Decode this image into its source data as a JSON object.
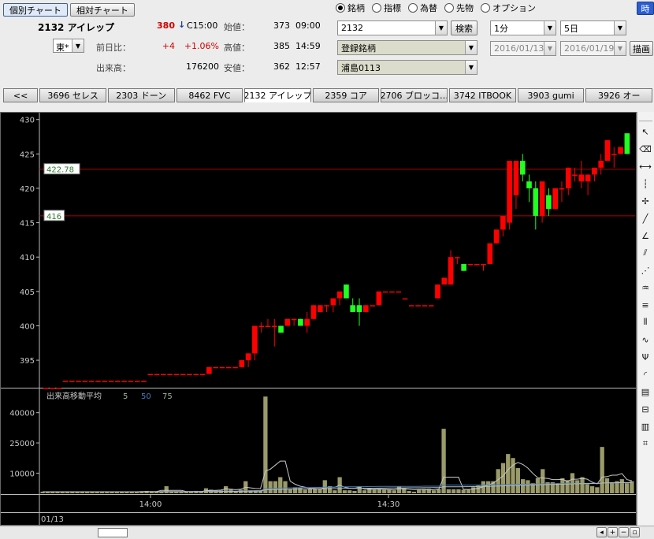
{
  "header": {
    "tab_individual": "個別チャート",
    "tab_relative": "相対チャート",
    "stock_label": "2132 アイレップ",
    "exchange": "東*",
    "price": "380",
    "price_arrow": "↓",
    "price_time": "C15:00",
    "change_label": "前日比：",
    "change_value": "+4",
    "change_pct": "+1.06%",
    "volume_label": "出来高：",
    "volume_value": "176200",
    "open_label": "始値：",
    "open_value": "373",
    "open_time": "09:00",
    "high_label": "高値：",
    "high_value": "385",
    "high_time": "14:59",
    "low_label": "安値：",
    "low_value": "362",
    "low_time": "12:57"
  },
  "modes": {
    "options": [
      "銘柄",
      "指標",
      "為替",
      "先物",
      "オプション"
    ],
    "selected": "銘柄"
  },
  "controls": {
    "code_value": "2132",
    "search_label": "検索",
    "list_value": "登録銘柄",
    "group_value": "浦島0113",
    "interval_value": "1分",
    "period_value": "5日",
    "date_from": "2016/01/13",
    "date_to": "2016/01/19",
    "draw_label": "描画",
    "corner_label": "時"
  },
  "stock_tabs": {
    "back": "<<",
    "items": [
      "3696 セレス",
      "2303 ドーン",
      "8462 FVC",
      "2132 アイレップ",
      "2359 コア",
      "2706 ブロッコ…",
      "3742 ITBOOK",
      "3903 gumi",
      "3926 オー"
    ],
    "active": "2132 アイレップ"
  },
  "chart_data": [
    {
      "type": "candlestick",
      "y_ticks": [
        395,
        400,
        405,
        410,
        415,
        420,
        425,
        430
      ],
      "ylim": [
        391,
        431
      ],
      "x_ticks": [
        "14:00",
        "14:30"
      ],
      "date_label": "01/13",
      "horizontal_lines": [
        {
          "label": "422.78",
          "value": 422.78
        },
        {
          "label": "416",
          "value": 416
        }
      ],
      "candles": [
        {
          "o": 391,
          "h": 391,
          "l": 391,
          "c": 391
        },
        {
          "o": 391,
          "h": 391,
          "l": 391,
          "c": 391
        },
        {
          "o": 391,
          "h": 391,
          "l": 391,
          "c": 391
        },
        {
          "o": 392,
          "h": 392,
          "l": 392,
          "c": 392
        },
        {
          "o": 392,
          "h": 392,
          "l": 392,
          "c": 392
        },
        {
          "o": 392,
          "h": 392,
          "l": 392,
          "c": 392
        },
        {
          "o": 392,
          "h": 392,
          "l": 392,
          "c": 392
        },
        {
          "o": 392,
          "h": 392,
          "l": 392,
          "c": 392
        },
        {
          "o": 392,
          "h": 392,
          "l": 392,
          "c": 392
        },
        {
          "o": 392,
          "h": 392,
          "l": 392,
          "c": 392
        },
        {
          "o": 392,
          "h": 392,
          "l": 392,
          "c": 392
        },
        {
          "o": 392,
          "h": 392,
          "l": 392,
          "c": 392
        },
        {
          "o": 392,
          "h": 392,
          "l": 392,
          "c": 392
        },
        {
          "o": 392,
          "h": 392,
          "l": 392,
          "c": 392
        },
        {
          "o": 392,
          "h": 392,
          "l": 392,
          "c": 392
        },
        {
          "o": 392,
          "h": 392,
          "l": 392,
          "c": 392
        },
        {
          "o": 393,
          "h": 393,
          "l": 393,
          "c": 393
        },
        {
          "o": 393,
          "h": 393,
          "l": 393,
          "c": 393
        },
        {
          "o": 393,
          "h": 393,
          "l": 393,
          "c": 393
        },
        {
          "o": 393,
          "h": 393,
          "l": 393,
          "c": 393
        },
        {
          "o": 393,
          "h": 393,
          "l": 393,
          "c": 393
        },
        {
          "o": 393,
          "h": 393,
          "l": 393,
          "c": 393
        },
        {
          "o": 393,
          "h": 393,
          "l": 393,
          "c": 393
        },
        {
          "o": 393,
          "h": 393,
          "l": 393,
          "c": 393
        },
        {
          "o": 393,
          "h": 393,
          "l": 393,
          "c": 393
        },
        {
          "o": 393,
          "h": 394,
          "l": 393,
          "c": 394
        },
        {
          "o": 394,
          "h": 394,
          "l": 394,
          "c": 394
        },
        {
          "o": 394,
          "h": 394,
          "l": 394,
          "c": 394
        },
        {
          "o": 394,
          "h": 394,
          "l": 394,
          "c": 394
        },
        {
          "o": 394,
          "h": 394,
          "l": 394,
          "c": 394
        },
        {
          "o": 394,
          "h": 395,
          "l": 394,
          "c": 395
        },
        {
          "o": 395,
          "h": 396,
          "l": 394,
          "c": 396
        },
        {
          "o": 396,
          "h": 400,
          "l": 395,
          "c": 400
        },
        {
          "o": 400,
          "h": 400.5,
          "l": 399,
          "c": 400
        },
        {
          "o": 400,
          "h": 401,
          "l": 400,
          "c": 400
        },
        {
          "o": 400,
          "h": 401,
          "l": 397,
          "c": 400
        },
        {
          "o": 400,
          "h": 400,
          "l": 399,
          "c": 399
        },
        {
          "o": 400,
          "h": 401,
          "l": 400,
          "c": 401
        },
        {
          "o": 401,
          "h": 401,
          "l": 400,
          "c": 401
        },
        {
          "o": 401,
          "h": 401,
          "l": 400,
          "c": 400
        },
        {
          "o": 400,
          "h": 402,
          "l": 399,
          "c": 401
        },
        {
          "o": 401,
          "h": 403,
          "l": 401,
          "c": 403
        },
        {
          "o": 402,
          "h": 403,
          "l": 402,
          "c": 403
        },
        {
          "o": 403,
          "h": 403,
          "l": 402,
          "c": 403
        },
        {
          "o": 403,
          "h": 404,
          "l": 402,
          "c": 404
        },
        {
          "o": 404,
          "h": 405,
          "l": 403,
          "c": 405
        },
        {
          "o": 406,
          "h": 406,
          "l": 404,
          "c": 404
        },
        {
          "o": 403,
          "h": 404,
          "l": 402,
          "c": 402
        },
        {
          "o": 403,
          "h": 404,
          "l": 400,
          "c": 402
        },
        {
          "o": 402,
          "h": 403,
          "l": 402,
          "c": 403
        },
        {
          "o": 403,
          "h": 403,
          "l": 403,
          "c": 403
        },
        {
          "o": 403,
          "h": 405,
          "l": 403,
          "c": 405
        },
        {
          "o": 405,
          "h": 405,
          "l": 405,
          "c": 405
        },
        {
          "o": 405,
          "h": 405,
          "l": 405,
          "c": 405
        },
        {
          "o": 405,
          "h": 405,
          "l": 405,
          "c": 405
        },
        {
          "o": 404,
          "h": 404,
          "l": 404,
          "c": 404
        },
        {
          "o": 403,
          "h": 403,
          "l": 403,
          "c": 403
        },
        {
          "o": 403,
          "h": 403,
          "l": 403,
          "c": 403
        },
        {
          "o": 403,
          "h": 403,
          "l": 403,
          "c": 403
        },
        {
          "o": 403,
          "h": 403,
          "l": 403,
          "c": 403
        },
        {
          "o": 404,
          "h": 406,
          "l": 404,
          "c": 406
        },
        {
          "o": 406,
          "h": 407,
          "l": 406,
          "c": 407
        },
        {
          "o": 406,
          "h": 411,
          "l": 406,
          "c": 410
        },
        {
          "o": 410,
          "h": 410,
          "l": 409,
          "c": 410
        },
        {
          "o": 409,
          "h": 409,
          "l": 408,
          "c": 408
        },
        {
          "o": 409,
          "h": 409,
          "l": 409,
          "c": 409
        },
        {
          "o": 409,
          "h": 409,
          "l": 409,
          "c": 409
        },
        {
          "o": 409,
          "h": 409,
          "l": 408,
          "c": 409
        },
        {
          "o": 409,
          "h": 412,
          "l": 409,
          "c": 412
        },
        {
          "o": 412,
          "h": 414,
          "l": 412,
          "c": 414
        },
        {
          "o": 414,
          "h": 416,
          "l": 413,
          "c": 416
        },
        {
          "o": 415,
          "h": 424,
          "l": 414,
          "c": 424
        },
        {
          "o": 419,
          "h": 424,
          "l": 417,
          "c": 424
        },
        {
          "o": 424,
          "h": 425,
          "l": 421,
          "c": 422
        },
        {
          "o": 421,
          "h": 422,
          "l": 418,
          "c": 420
        },
        {
          "o": 420,
          "h": 421,
          "l": 414,
          "c": 416
        },
        {
          "o": 416,
          "h": 419,
          "l": 415,
          "c": 421
        },
        {
          "o": 419,
          "h": 420,
          "l": 416,
          "c": 417
        },
        {
          "o": 417,
          "h": 420,
          "l": 417,
          "c": 420
        },
        {
          "o": 420,
          "h": 421,
          "l": 418,
          "c": 420
        },
        {
          "o": 420,
          "h": 423,
          "l": 419,
          "c": 423
        },
        {
          "o": 422,
          "h": 423,
          "l": 421,
          "c": 422
        },
        {
          "o": 421,
          "h": 424,
          "l": 420,
          "c": 422
        },
        {
          "o": 421,
          "h": 422,
          "l": 419,
          "c": 422
        },
        {
          "o": 422,
          "h": 423,
          "l": 421,
          "c": 423
        },
        {
          "o": 423,
          "h": 425,
          "l": 422,
          "c": 424
        },
        {
          "o": 424,
          "h": 427,
          "l": 424,
          "c": 427
        },
        {
          "o": 425,
          "h": 426,
          "l": 423,
          "c": 425
        },
        {
          "o": 425,
          "h": 426,
          "l": 425,
          "c": 426
        },
        {
          "o": 428,
          "h": 428,
          "l": 425,
          "c": 425
        }
      ]
    },
    {
      "type": "bar",
      "title": "出来高移動平均",
      "ma_labels": [
        "5",
        "50",
        "75"
      ],
      "y_ticks": [
        10000,
        25000,
        40000
      ],
      "ylim": [
        0,
        52000
      ],
      "values": [
        800,
        800,
        800,
        800,
        800,
        800,
        800,
        800,
        800,
        800,
        800,
        800,
        800,
        800,
        800,
        800,
        800,
        800,
        800,
        800,
        800,
        1200,
        800,
        800,
        800,
        3500,
        800,
        800,
        800,
        800,
        800,
        1200,
        800,
        2500,
        1800,
        1500,
        1500,
        3500,
        2200,
        800,
        1800,
        6000,
        1500,
        1500,
        1200,
        48000,
        6000,
        6000,
        8000,
        6000,
        2000,
        3000,
        2800,
        1800,
        2200,
        2500,
        2500,
        6500,
        3500,
        1500,
        8000,
        1500,
        1500,
        1200,
        3500,
        1500,
        2500,
        2000,
        2000,
        1800,
        1800,
        1500,
        3500,
        2500,
        1200,
        800,
        1800,
        2200,
        2200,
        1500,
        2200,
        32000,
        2000,
        2000,
        2000,
        1800,
        1800,
        3000,
        3800,
        6000,
        6000,
        6000,
        12000,
        15000,
        19500,
        17500,
        12500,
        7000,
        6500,
        5000,
        7500,
        12000,
        5500,
        5500,
        5000,
        7500,
        6500,
        10000,
        6500,
        8000,
        4500,
        3500,
        3000,
        23000,
        7500,
        5500,
        6000,
        7000,
        5000,
        6000
      ],
      "ma5": [
        800,
        800,
        800,
        800,
        800,
        800,
        800,
        800,
        800,
        800,
        800,
        800,
        800,
        800,
        800,
        800,
        800,
        800,
        800,
        800,
        900,
        900,
        900,
        900,
        1500,
        1500,
        1500,
        1500,
        1500,
        900,
        800,
        800,
        900,
        1300,
        1400,
        1500,
        1600,
        2200,
        2000,
        1800,
        2000,
        3000,
        2700,
        2400,
        2300,
        11000,
        12000,
        14000,
        16000,
        16000,
        6000,
        4500,
        3500,
        3000,
        2500,
        2400,
        2200,
        2800,
        3000,
        3000,
        4000,
        3000,
        2500,
        2500,
        3000,
        2000,
        2000,
        2000,
        2100,
        2000,
        1900,
        1800,
        2200,
        2200,
        2000,
        1800,
        1900,
        1900,
        1700,
        1800,
        2000,
        8000,
        8000,
        8000,
        8000,
        2000,
        1900,
        2100,
        2500,
        3300,
        4200,
        5000,
        6800,
        8600,
        11700,
        14000,
        15300,
        14300,
        12500,
        9900,
        7700,
        7600,
        7400,
        6800,
        6800,
        6900,
        6000,
        7000,
        7000,
        7400,
        7000,
        5500,
        4700,
        8000,
        8300,
        9000,
        9000,
        9800,
        6800,
        6200
      ],
      "ma50": [
        800,
        800,
        800,
        800,
        800,
        800,
        800,
        800,
        800,
        800,
        800,
        800,
        800,
        800,
        800,
        800,
        800,
        800,
        800,
        800,
        800,
        800,
        800,
        800,
        850,
        850,
        850,
        850,
        850,
        850,
        900,
        900,
        900,
        950,
        1000,
        1000,
        1050,
        1100,
        1150,
        1150,
        1200,
        1300,
        1300,
        1350,
        1350,
        2300,
        2400,
        2500,
        2600,
        2700,
        2700,
        2750,
        2800,
        2800,
        2850,
        2900,
        2950,
        3000,
        3050,
        3050,
        3200,
        3200,
        3250,
        3250,
        3300,
        3300,
        3350,
        3350,
        3400,
        3400,
        3400,
        3400,
        3450,
        3450,
        3450,
        3450,
        3450,
        3500,
        3500,
        3500,
        3500,
        4100,
        4100,
        4100,
        4100,
        4100,
        4050,
        4050,
        4100,
        4150,
        4200,
        4200,
        4300,
        4300,
        4400,
        4400,
        4500,
        4500,
        4500,
        4600,
        4600,
        4700,
        4700,
        4700,
        4800,
        4800,
        4800,
        4900,
        4900,
        4900,
        4950,
        4950,
        5000,
        5100,
        5100,
        5100,
        5200,
        5200,
        5200,
        5300
      ],
      "ma75": [
        800,
        800,
        800,
        800,
        800,
        800,
        800,
        800,
        800,
        800,
        800,
        800,
        800,
        800,
        800,
        800,
        800,
        800,
        800,
        800,
        800,
        800,
        800,
        800,
        820,
        820,
        820,
        820,
        820,
        820,
        850,
        850,
        850,
        880,
        900,
        900,
        930,
        950,
        980,
        980,
        1000,
        1100,
        1100,
        1150,
        1150,
        1800,
        1850,
        1900,
        1950,
        2000,
        2050,
        2100,
        2120,
        2150,
        2170,
        2200,
        2230,
        2260,
        2300,
        2320,
        2400,
        2420,
        2450,
        2460,
        2500,
        2520,
        2540,
        2560,
        2580,
        2600,
        2620,
        2640,
        2680,
        2700,
        2720,
        2730,
        2740,
        2760,
        2780,
        2800,
        2820,
        3200,
        3220,
        3240,
        3260,
        3280,
        3300,
        3320,
        3360,
        3400,
        3450,
        3500,
        3580,
        3660,
        3780,
        3900,
        4000,
        4060,
        4120,
        4180,
        4240,
        4320,
        4380,
        4430,
        4480,
        4540,
        4600,
        4680,
        4720,
        4780,
        4820,
        4850,
        4880,
        5100,
        5150,
        5200,
        5250,
        5300,
        5320,
        5350
      ]
    }
  ],
  "colors": {
    "up": "#ff0000",
    "down": "#20ff20",
    "grid_line": "#b00000",
    "volume_bar": "#9b9b6a",
    "axis_text": "#c8c8c8",
    "ma5": "#c8c8c8",
    "ma50": "#3f7fc0",
    "ma75": "#bcbcbc"
  },
  "icons": [
    "cursor-icon",
    "eraser-icon",
    "horizontal-line-icon",
    "vertical-line-icon",
    "cross-icon",
    "trend-line-icon",
    "angle-line-icon",
    "channel-icon",
    "fan-icon",
    "fibonacci-icon",
    "retracement-icon",
    "period-icon",
    "wave-icon",
    "pitchfork-icon",
    "arc-icon",
    "text-box-icon",
    "level-icon",
    "bars-icon",
    "gann-icon"
  ]
}
